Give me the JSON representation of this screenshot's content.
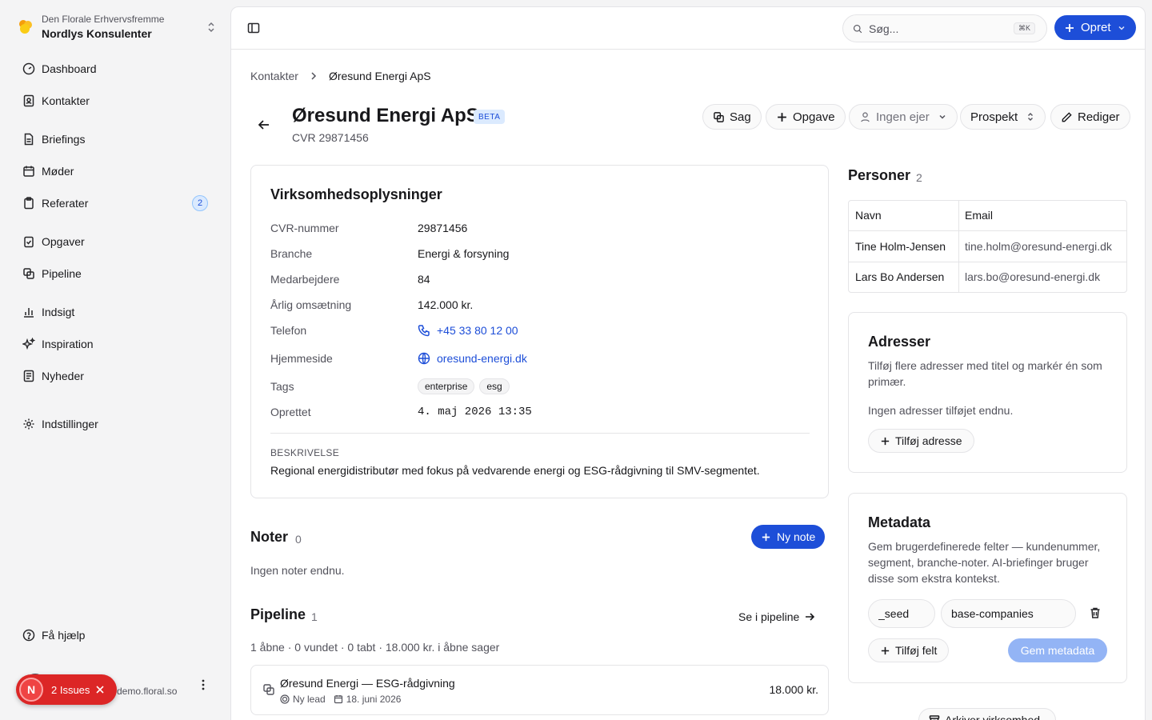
{
  "sidebar": {
    "org_sub": "Den Florale Erhvervsfremme",
    "org_name": "Nordlys Konsulenter",
    "items": [
      {
        "label": "Dashboard",
        "icon": "gauge-icon"
      },
      {
        "label": "Kontakter",
        "icon": "contacts-icon"
      },
      {
        "label": "Briefings",
        "icon": "file-icon"
      },
      {
        "label": "Møder",
        "icon": "calendar-icon"
      },
      {
        "label": "Referater",
        "icon": "clipboard-icon",
        "badge": "2"
      },
      {
        "label": "Opgaver",
        "icon": "clipboard-check-icon"
      },
      {
        "label": "Pipeline",
        "icon": "layers-icon"
      },
      {
        "label": "Indsigt",
        "icon": "bar-chart-icon"
      },
      {
        "label": "Inspiration",
        "icon": "sparkles-icon"
      },
      {
        "label": "Nyheder",
        "icon": "newspaper-icon"
      },
      {
        "label": "Indstillinger",
        "icon": "gear-icon"
      }
    ],
    "help": "Få hjælp",
    "user_email": "demo.floral.so"
  },
  "issues": {
    "logo": "N",
    "label": "2 Issues"
  },
  "topbar": {
    "search_placeholder": "Søg...",
    "shortcut": "⌘K",
    "create_label": "Opret"
  },
  "breadcrumb": {
    "parent": "Kontakter",
    "current": "Øresund Energi ApS"
  },
  "header": {
    "title": "Øresund Energi ApS",
    "badge": "BETA",
    "subtitle": "CVR 29871456",
    "buttons": {
      "case": "Sag",
      "task": "Opgave",
      "owner": "Ingen ejer",
      "status": "Prospekt",
      "edit": "Rediger"
    }
  },
  "company": {
    "title": "Virksomhedsoplysninger",
    "fields": [
      {
        "label": "CVR-nummer",
        "value": "29871456"
      },
      {
        "label": "Branche",
        "value": "Energi & forsyning"
      },
      {
        "label": "Medarbejdere",
        "value": "84"
      },
      {
        "label": "Årlig omsætning",
        "value": "142.000 kr."
      },
      {
        "label": "Telefon",
        "value": "+45 33 80 12 00"
      },
      {
        "label": "Hjemmeside",
        "value": "oresund-energi.dk"
      },
      {
        "label": "Tags",
        "tags": [
          "enterprise",
          "esg"
        ]
      },
      {
        "label": "Oprettet",
        "value": "4. maj 2026 13:35"
      }
    ],
    "description_caption": "BESKRIVELSE",
    "description": "Regional energidistributør med fokus på vedvarende energi og ESG-rådgivning til SMV-segmentet."
  },
  "notes": {
    "title": "Noter",
    "count": "0",
    "new_label": "Ny note",
    "empty": "Ingen noter endnu."
  },
  "pipeline": {
    "title": "Pipeline",
    "count": "1",
    "see_label": "Se i pipeline",
    "summary": "1 åbne · 0 vundet · 0 tabt · 18.000 kr. i åbne sager",
    "deal": {
      "title": "Øresund Energi — ESG-rådgivning",
      "stage": "Ny lead",
      "date": "18. juni 2026",
      "amount": "18.000 kr."
    }
  },
  "persons": {
    "title": "Personer",
    "count": "2",
    "columns": [
      "Navn",
      "Email"
    ],
    "rows": [
      {
        "name": "Tine Holm-Jensen",
        "email": "tine.holm@oresund-energi.dk"
      },
      {
        "name": "Lars Bo Andersen",
        "email": "lars.bo@oresund-energi.dk"
      }
    ]
  },
  "addresses": {
    "title": "Adresser",
    "description": "Tilføj flere adresser med titel og markér én som primær.",
    "empty": "Ingen adresser tilføjet endnu.",
    "add_label": "Tilføj adresse"
  },
  "metadata": {
    "title": "Metadata",
    "description": "Gem brugerdefinerede felter — kundenummer, segment, branche-noter. AI-briefinger bruger disse som ekstra kontekst.",
    "key": "_seed",
    "value": "base-companies",
    "add_field": "Tilføj felt",
    "save": "Gem metadata"
  },
  "archive_label": "Arkiver virksomhed",
  "colors": {
    "accent": "#1d4ed8",
    "danger": "#dc2626"
  }
}
